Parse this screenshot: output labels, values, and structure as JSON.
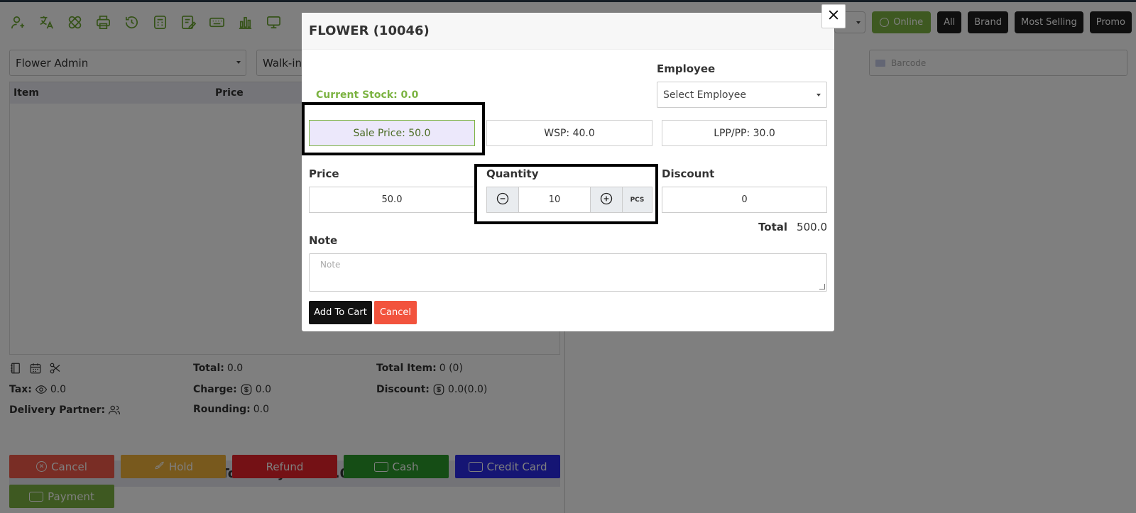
{
  "toolbar": {
    "icons": [
      "user-icon",
      "translate-icon",
      "bandage-icon",
      "printer-icon",
      "history-icon",
      "calculator-icon",
      "edit-list-icon",
      "keyboard-icon",
      "bar-chart-icon",
      "monitor-icon"
    ],
    "online_label": "Online",
    "filter_buttons": [
      "All",
      "Brand",
      "Most Selling",
      "Promo"
    ]
  },
  "left": {
    "admin_select": "Flower Admin",
    "customer_select": "Walk-in",
    "table_headers": [
      "Item",
      "Price"
    ],
    "summary": {
      "total_label": "Total:",
      "total_value": "0.0",
      "total_item_label": "Total Item:",
      "total_item_value": "0 (0)",
      "tax_label": "Tax:",
      "tax_value": "0.0",
      "charge_label": "Charge:",
      "charge_value": "0.0",
      "discount_label": "Discount:",
      "discount_value": "0.0(0.0)",
      "delivery_label": "Delivery Partner:",
      "rounding_label": "Rounding:",
      "rounding_value": "0.0"
    },
    "total_payable": "Total Payable: 0.0",
    "actions": {
      "cancel": "Cancel",
      "hold": "Hold",
      "refund": "Refund",
      "cash": "Cash",
      "credit_card": "Credit Card",
      "payment": "Payment"
    },
    "action_colors": {
      "cancel": "#f25a4a",
      "hold": "#f0b23a",
      "refund": "#e8232a",
      "cash": "#2a9a2a",
      "credit_card": "#2a2ae8",
      "payment": "#7cb342"
    }
  },
  "right": {
    "barcode_placeholder": "Barcode"
  },
  "modal": {
    "title": "FLOWER (10046)",
    "current_stock": "Current Stock: 0.0",
    "employee_label": "Employee",
    "employee_select": "Select Employee",
    "price_options": {
      "sale": "Sale Price: 50.0",
      "wsp": "WSP: 40.0",
      "lpp": "LPP/PP: 30.0"
    },
    "price_label": "Price",
    "price_value": "50.0",
    "quantity_label": "Quantity",
    "quantity_value": "10",
    "unit": "PCS",
    "discount_label": "Discount",
    "discount_value": "0",
    "total_label": "Total",
    "total_value": "500.0",
    "note_label": "Note",
    "note_placeholder": "Note",
    "add_to_cart": "Add To Cart",
    "cancel": "Cancel"
  },
  "colors": {
    "accent_green": "#7cb342",
    "dark_button": "#1e1e1e",
    "cancel_red": "#f2533d"
  }
}
